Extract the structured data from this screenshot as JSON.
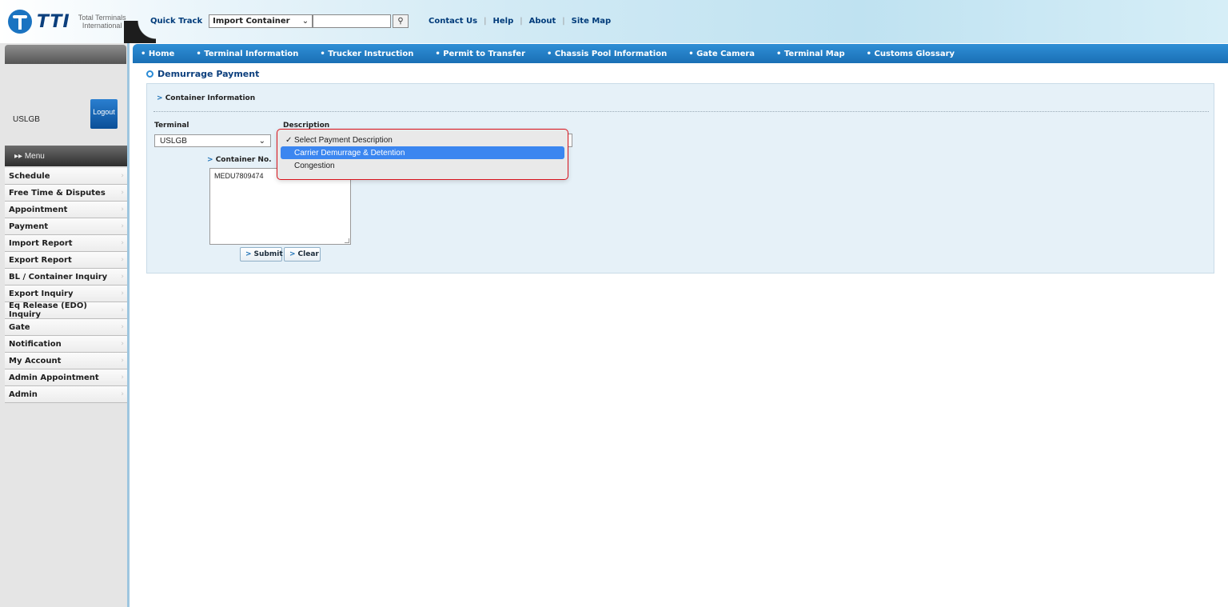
{
  "header": {
    "logo_text": "TTI",
    "logo_sub_line1": "Total Terminals",
    "logo_sub_line2": "International",
    "quick_track_label": "Quick Track",
    "quick_track_select": "Import Container",
    "search_value": "",
    "links": [
      "Contact Us",
      "Help",
      "About",
      "Site Map"
    ]
  },
  "nav": {
    "items": [
      "Home",
      "Terminal Information",
      "Trucker Instruction",
      "Permit to Transfer",
      "Chassis Pool Information",
      "Gate Camera",
      "Terminal Map",
      "Customs Glossary"
    ]
  },
  "sidebar": {
    "user": "USLGB",
    "logout_label": "Logout",
    "menu_label": "▸▸ Menu",
    "items": [
      "Schedule",
      "Free Time & Disputes",
      "Appointment",
      "Payment",
      "Import Report",
      "Export Report",
      "BL / Container Inquiry",
      "Export Inquiry",
      "Eq Release (EDO) Inquiry",
      "Gate",
      "Notification",
      "My Account",
      "Admin Appointment",
      "Admin"
    ]
  },
  "main": {
    "title": "Demurrage Payment",
    "section_label": "Container Information",
    "terminal_label": "Terminal",
    "terminal_value": "USLGB",
    "description_label": "Description",
    "container_label": "Container No.",
    "container_value": "MEDU7809474",
    "submit_label": "Submit",
    "clear_label": "Clear"
  },
  "dropdown": {
    "options": [
      "Select Payment Description",
      "Carrier Demurrage & Detention",
      "Congestion"
    ],
    "checked_index": 0,
    "highlighted_index": 1,
    "highlight_color": "#3b86f0",
    "border_color": "#d9121b"
  }
}
